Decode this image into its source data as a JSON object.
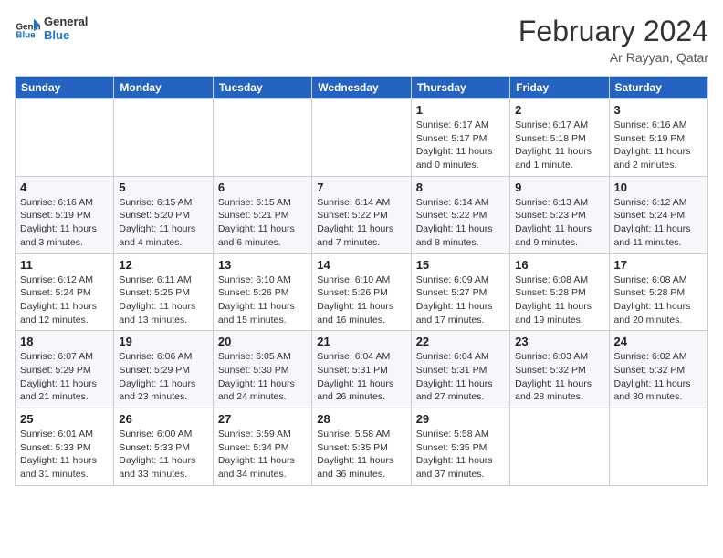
{
  "logo": {
    "general": "General",
    "blue": "Blue"
  },
  "title": "February 2024",
  "subtitle": "Ar Rayyan, Qatar",
  "weekdays": [
    "Sunday",
    "Monday",
    "Tuesday",
    "Wednesday",
    "Thursday",
    "Friday",
    "Saturday"
  ],
  "weeks": [
    [
      {
        "day": "",
        "info": ""
      },
      {
        "day": "",
        "info": ""
      },
      {
        "day": "",
        "info": ""
      },
      {
        "day": "",
        "info": ""
      },
      {
        "day": "1",
        "info": "Sunrise: 6:17 AM\nSunset: 5:17 PM\nDaylight: 11 hours\nand 0 minutes."
      },
      {
        "day": "2",
        "info": "Sunrise: 6:17 AM\nSunset: 5:18 PM\nDaylight: 11 hours\nand 1 minute."
      },
      {
        "day": "3",
        "info": "Sunrise: 6:16 AM\nSunset: 5:19 PM\nDaylight: 11 hours\nand 2 minutes."
      }
    ],
    [
      {
        "day": "4",
        "info": "Sunrise: 6:16 AM\nSunset: 5:19 PM\nDaylight: 11 hours\nand 3 minutes."
      },
      {
        "day": "5",
        "info": "Sunrise: 6:15 AM\nSunset: 5:20 PM\nDaylight: 11 hours\nand 4 minutes."
      },
      {
        "day": "6",
        "info": "Sunrise: 6:15 AM\nSunset: 5:21 PM\nDaylight: 11 hours\nand 6 minutes."
      },
      {
        "day": "7",
        "info": "Sunrise: 6:14 AM\nSunset: 5:22 PM\nDaylight: 11 hours\nand 7 minutes."
      },
      {
        "day": "8",
        "info": "Sunrise: 6:14 AM\nSunset: 5:22 PM\nDaylight: 11 hours\nand 8 minutes."
      },
      {
        "day": "9",
        "info": "Sunrise: 6:13 AM\nSunset: 5:23 PM\nDaylight: 11 hours\nand 9 minutes."
      },
      {
        "day": "10",
        "info": "Sunrise: 6:12 AM\nSunset: 5:24 PM\nDaylight: 11 hours\nand 11 minutes."
      }
    ],
    [
      {
        "day": "11",
        "info": "Sunrise: 6:12 AM\nSunset: 5:24 PM\nDaylight: 11 hours\nand 12 minutes."
      },
      {
        "day": "12",
        "info": "Sunrise: 6:11 AM\nSunset: 5:25 PM\nDaylight: 11 hours\nand 13 minutes."
      },
      {
        "day": "13",
        "info": "Sunrise: 6:10 AM\nSunset: 5:26 PM\nDaylight: 11 hours\nand 15 minutes."
      },
      {
        "day": "14",
        "info": "Sunrise: 6:10 AM\nSunset: 5:26 PM\nDaylight: 11 hours\nand 16 minutes."
      },
      {
        "day": "15",
        "info": "Sunrise: 6:09 AM\nSunset: 5:27 PM\nDaylight: 11 hours\nand 17 minutes."
      },
      {
        "day": "16",
        "info": "Sunrise: 6:08 AM\nSunset: 5:28 PM\nDaylight: 11 hours\nand 19 minutes."
      },
      {
        "day": "17",
        "info": "Sunrise: 6:08 AM\nSunset: 5:28 PM\nDaylight: 11 hours\nand 20 minutes."
      }
    ],
    [
      {
        "day": "18",
        "info": "Sunrise: 6:07 AM\nSunset: 5:29 PM\nDaylight: 11 hours\nand 21 minutes."
      },
      {
        "day": "19",
        "info": "Sunrise: 6:06 AM\nSunset: 5:29 PM\nDaylight: 11 hours\nand 23 minutes."
      },
      {
        "day": "20",
        "info": "Sunrise: 6:05 AM\nSunset: 5:30 PM\nDaylight: 11 hours\nand 24 minutes."
      },
      {
        "day": "21",
        "info": "Sunrise: 6:04 AM\nSunset: 5:31 PM\nDaylight: 11 hours\nand 26 minutes."
      },
      {
        "day": "22",
        "info": "Sunrise: 6:04 AM\nSunset: 5:31 PM\nDaylight: 11 hours\nand 27 minutes."
      },
      {
        "day": "23",
        "info": "Sunrise: 6:03 AM\nSunset: 5:32 PM\nDaylight: 11 hours\nand 28 minutes."
      },
      {
        "day": "24",
        "info": "Sunrise: 6:02 AM\nSunset: 5:32 PM\nDaylight: 11 hours\nand 30 minutes."
      }
    ],
    [
      {
        "day": "25",
        "info": "Sunrise: 6:01 AM\nSunset: 5:33 PM\nDaylight: 11 hours\nand 31 minutes."
      },
      {
        "day": "26",
        "info": "Sunrise: 6:00 AM\nSunset: 5:33 PM\nDaylight: 11 hours\nand 33 minutes."
      },
      {
        "day": "27",
        "info": "Sunrise: 5:59 AM\nSunset: 5:34 PM\nDaylight: 11 hours\nand 34 minutes."
      },
      {
        "day": "28",
        "info": "Sunrise: 5:58 AM\nSunset: 5:35 PM\nDaylight: 11 hours\nand 36 minutes."
      },
      {
        "day": "29",
        "info": "Sunrise: 5:58 AM\nSunset: 5:35 PM\nDaylight: 11 hours\nand 37 minutes."
      },
      {
        "day": "",
        "info": ""
      },
      {
        "day": "",
        "info": ""
      }
    ]
  ]
}
